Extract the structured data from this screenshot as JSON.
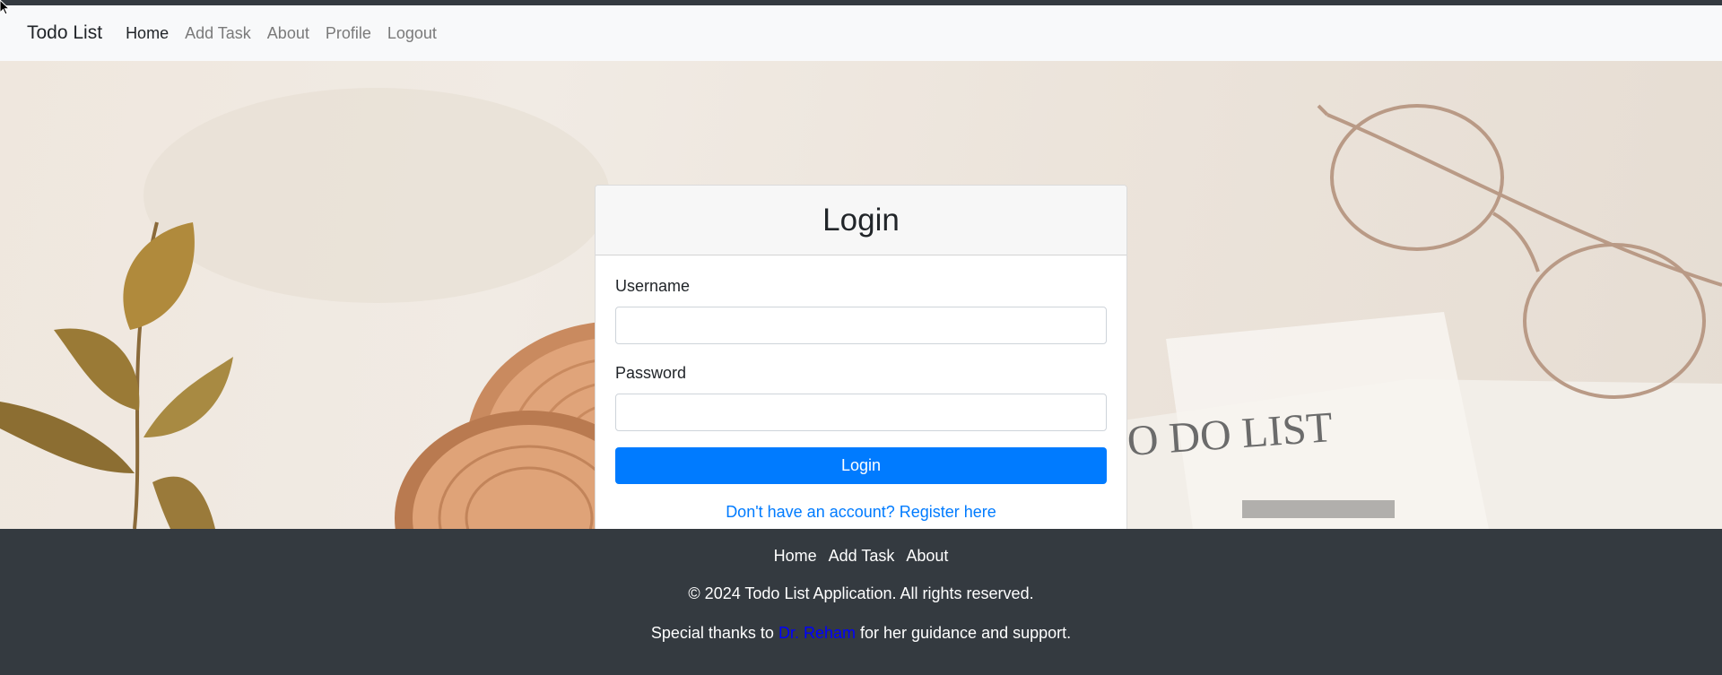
{
  "navbar": {
    "brand": "Todo List",
    "links": [
      "Home",
      "Add Task",
      "About",
      "Profile",
      "Logout"
    ]
  },
  "hero": {
    "notepad_text": "O DO LIST"
  },
  "login": {
    "title": "Login",
    "username_label": "Username",
    "username_value": "",
    "password_label": "Password",
    "password_value": "",
    "button_label": "Login",
    "register_text": "Don't have an account? Register here"
  },
  "footer": {
    "links": [
      "Home",
      "Add Task",
      "About"
    ],
    "copyright": "© 2024 Todo List Application. All rights reserved.",
    "thanks_before": "Special thanks to",
    "thanks_name": "Dr. Reham",
    "thanks_after": "for her guidance and support."
  },
  "colors": {
    "primary": "#007bff",
    "footer_bg": "#343a40",
    "navbar_bg": "#f8f9fa"
  }
}
